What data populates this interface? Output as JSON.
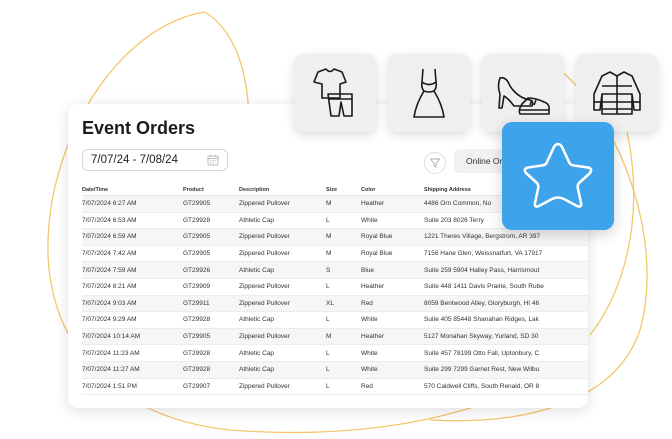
{
  "title": "Event Orders",
  "date_range": "7/07/24 - 7/08/24",
  "online_button": "Online Ord",
  "columns": [
    "Date/Time",
    "Product",
    "Description",
    "Size",
    "Color",
    "Shipping Address"
  ],
  "rows": [
    [
      "7/07/2024 6:27 AM",
      "GT29905",
      "Zippered Pullover",
      "M",
      "Heather",
      "4486 Orn Common, No"
    ],
    [
      "7/07/2024 6:53 AM",
      "GT29928",
      "Athletic Cap",
      "L",
      "White",
      "Suite 203 8026 Terry"
    ],
    [
      "7/07/2024 6:59 AM",
      "GT29905",
      "Zippered Pullover",
      "M",
      "Royal Blue",
      "1221 Theres Village, Bergstrom, AR 397"
    ],
    [
      "7/07/2024 7:42 AM",
      "GT29905",
      "Zippered Pullover",
      "M",
      "Royal Blue",
      "7156 Hane Glen, Weissnatfurt, VA 17917"
    ],
    [
      "7/07/2024 7:59 AM",
      "GT29926",
      "Athletic Cap",
      "S",
      "Blue",
      "Suite 259 5904 Halley Pass, Harrismout"
    ],
    [
      "7/07/2024 8:21 AM",
      "GT29909",
      "Zippered Pullover",
      "L",
      "Heather",
      "Suite 448 1411 Davis Prairie, South Rube"
    ],
    [
      "7/07/2024 9:03 AM",
      "GT29911",
      "Zippered Pullover",
      "XL",
      "Red",
      "8059 Bentwood Alley, Gloryburgh, HI 46"
    ],
    [
      "7/07/2024 9:29 AM",
      "GT29928",
      "Athletic Cap",
      "L",
      "White",
      "Suite 405 85448 Shanahan Ridges, Lak"
    ],
    [
      "7/07/2024 10:14 AM",
      "GT29905",
      "Zippered Pullover",
      "M",
      "Heather",
      "5127 Monahan Skyway, Yurland, SD 30"
    ],
    [
      "7/07/2024 11:23 AM",
      "GT29928",
      "Athletic Cap",
      "L",
      "White",
      "Suite 457 78199 Otto Fall, Uptonbury, C"
    ],
    [
      "7/07/2024 11:27 AM",
      "GT29928",
      "Athletic Cap",
      "L",
      "White",
      "Suite 299 7299 Garnet Rest, New Wilbu"
    ],
    [
      "7/07/2024 1:51 PM",
      "GT29907",
      "Zippered Pullover",
      "L",
      "Red",
      "570 Caldwell Cliffs, South Renald, OR 8"
    ]
  ],
  "icons": [
    "outfit-icon",
    "dress-icon",
    "shoes-icon",
    "puffer-jacket-icon",
    "star-icon",
    "calendar-icon",
    "filter-icon"
  ],
  "colors": {
    "accent_blue": "#3da3ea",
    "deco_line": "#f2c15a",
    "tile_bg": "#f0efef"
  }
}
